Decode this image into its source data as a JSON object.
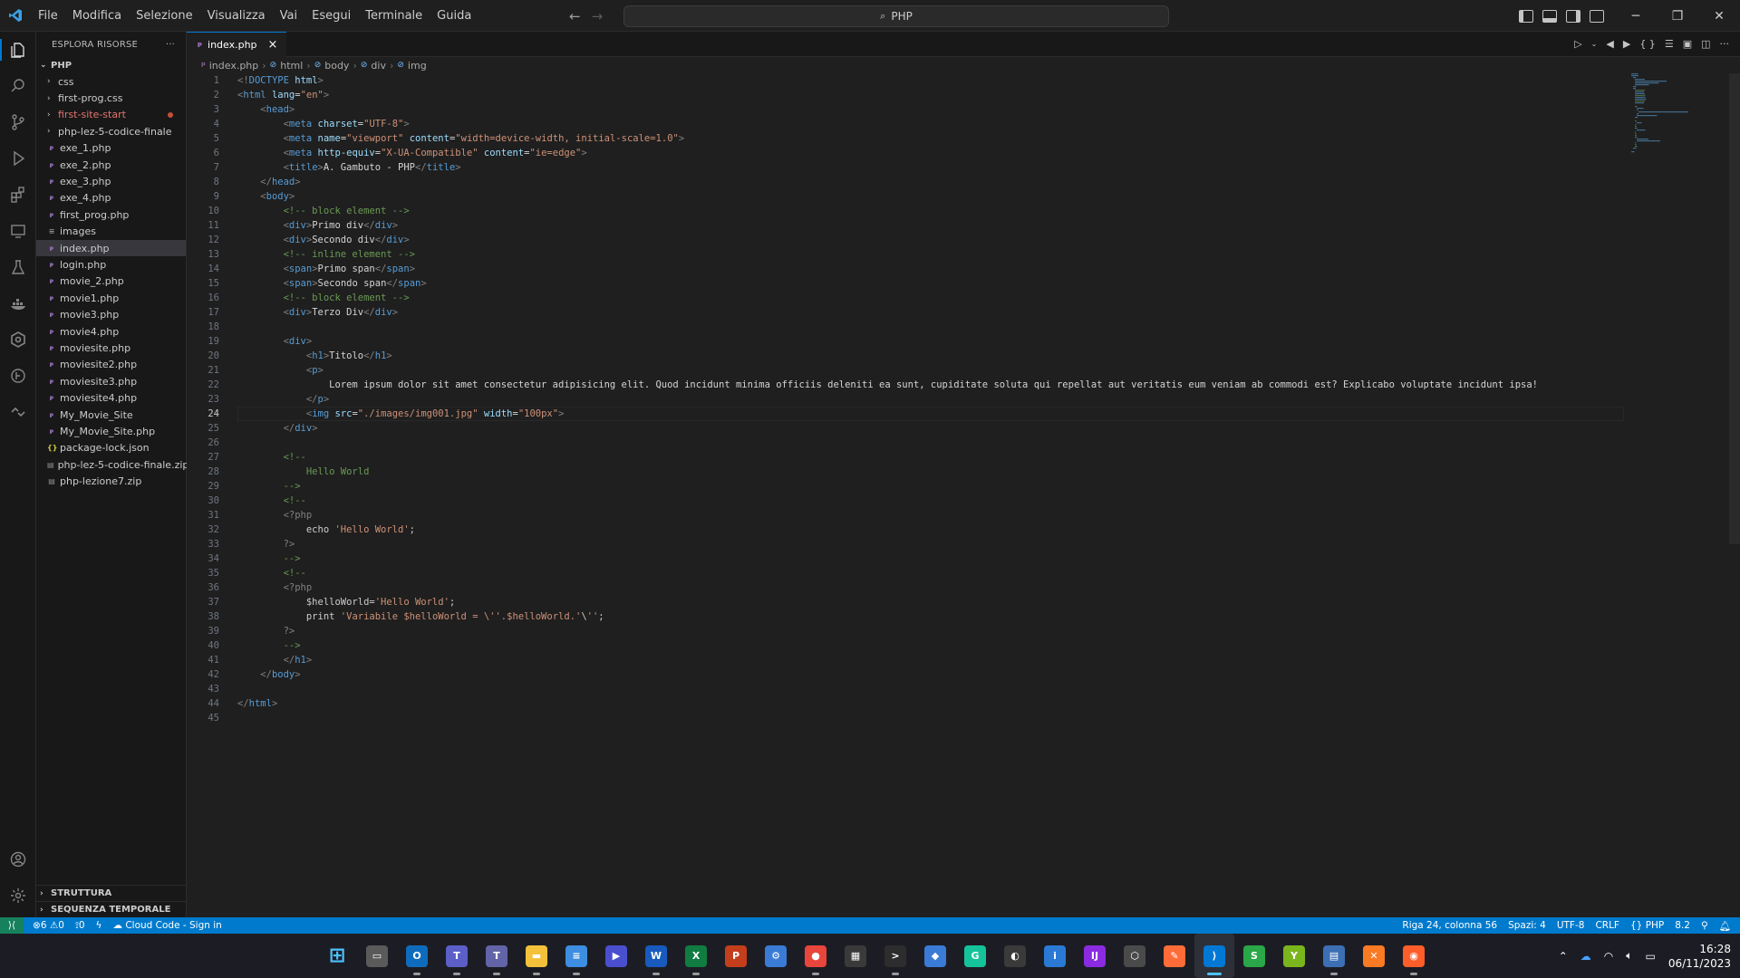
{
  "titlebar": {
    "menu": [
      "File",
      "Modifica",
      "Selezione",
      "Visualizza",
      "Vai",
      "Esegui",
      "Terminale",
      "Guida"
    ],
    "search": "PHP",
    "accent": "#0078d4"
  },
  "sidebar": {
    "title": "ESPLORA RISORSE",
    "more": "···",
    "project": "PHP",
    "items": [
      {
        "label": "css",
        "kind": "folder"
      },
      {
        "label": "first-prog.css",
        "kind": "folder"
      },
      {
        "label": "first-site-start",
        "kind": "folder-modified"
      },
      {
        "label": "php-lez-5-codice-finale",
        "kind": "folder"
      },
      {
        "label": "exe_1.php",
        "kind": "php"
      },
      {
        "label": "exe_2.php",
        "kind": "php"
      },
      {
        "label": "exe_3.php",
        "kind": "php"
      },
      {
        "label": "exe_4.php",
        "kind": "php"
      },
      {
        "label": "first_prog.php",
        "kind": "php"
      },
      {
        "label": "images",
        "kind": "file"
      },
      {
        "label": "index.php",
        "kind": "php-selected"
      },
      {
        "label": "login.php",
        "kind": "php"
      },
      {
        "label": "movie_2.php",
        "kind": "php"
      },
      {
        "label": "movie1.php",
        "kind": "php"
      },
      {
        "label": "movie3.php",
        "kind": "php"
      },
      {
        "label": "movie4.php",
        "kind": "php"
      },
      {
        "label": "moviesite.php",
        "kind": "php"
      },
      {
        "label": "moviesite2.php",
        "kind": "php"
      },
      {
        "label": "moviesite3.php",
        "kind": "php"
      },
      {
        "label": "moviesite4.php",
        "kind": "php"
      },
      {
        "label": "My_Movie_Site",
        "kind": "php"
      },
      {
        "label": "My_Movie_Site.php",
        "kind": "php"
      },
      {
        "label": "package-lock.json",
        "kind": "json"
      },
      {
        "label": "php-lez-5-codice-finale.zip",
        "kind": "zip"
      },
      {
        "label": "php-lezione7.zip",
        "kind": "zip"
      }
    ],
    "outline": "STRUTTURA",
    "timeline": "SEQUENZA TEMPORALE"
  },
  "editor": {
    "tab": "index.php",
    "tab_close": "×",
    "breadcrumb": [
      "index.php",
      "html",
      "body",
      "div",
      "img"
    ],
    "current_line": 24,
    "lines": [
      "<!DOCTYPE html>",
      "<html lang=\"en\">",
      "    <head>",
      "        <meta charset=\"UTF-8\">",
      "        <meta name=\"viewport\" content=\"width=device-width, initial-scale=1.0\">",
      "        <meta http-equiv=\"X-UA-Compatible\" content=\"ie=edge\">",
      "        <title>A. Gambuto - PHP</title>",
      "    </head>",
      "    <body>",
      "        <!-- block element -->",
      "        <div>Primo div</div>",
      "        <div>Secondo div</div>",
      "        <!-- inline element -->",
      "        <span>Primo span</span>",
      "        <span>Secondo span</span>",
      "        <!-- block element -->",
      "        <div>Terzo Div</div>",
      "",
      "        <div>",
      "            <h1>Titolo</h1>",
      "            <p>",
      "                Lorem ipsum dolor sit amet consectetur adipisicing elit. Quod incidunt minima officiis deleniti ea sunt, cupiditate soluta qui repellat aut veritatis eum veniam ab commodi est? Explicabo voluptate incidunt ipsa!",
      "            </p>",
      "            <img src=\"./images/img001.jpg\" width=\"100px\">",
      "        </div>",
      "",
      "        <!--",
      "            Hello World",
      "        -->",
      "        <!--",
      "        <?php",
      "            echo 'Hello World';",
      "        ?>",
      "        -->",
      "        <!--",
      "        <?php",
      "            $helloWorld='Hello World';",
      "            print 'Variabile $helloWorld = \\''.$helloWorld.'\\'';",
      "        ?>",
      "        -->",
      "        </h1>",
      "    </body>",
      "",
      "</html>",
      ""
    ]
  },
  "statusbar": {
    "errors": "6",
    "warnings": "0",
    "ports": "0",
    "cloud": "Cloud Code - Sign in",
    "position": "Riga 24, colonna 56",
    "spaces": "Spazi: 4",
    "encoding": "UTF-8",
    "eol": "CRLF",
    "language": "PHP",
    "version": "8.2"
  },
  "taskbar": {
    "apps": [
      {
        "name": "start",
        "color": "#4cc2ff",
        "glyph": "⊞"
      },
      {
        "name": "task-view",
        "color": "#5a5a5a",
        "glyph": "▭"
      },
      {
        "name": "outlook",
        "color": "#0f6cbd",
        "glyph": "O"
      },
      {
        "name": "teams-work",
        "color": "#5b5fc7",
        "glyph": "T"
      },
      {
        "name": "teams",
        "color": "#6264a7",
        "glyph": "T"
      },
      {
        "name": "file-explorer",
        "color": "#f3c13a",
        "glyph": "▬"
      },
      {
        "name": "notepad",
        "color": "#3d8de0",
        "glyph": "≡"
      },
      {
        "name": "clipchamp",
        "color": "#4a4fcf",
        "glyph": "▶"
      },
      {
        "name": "word",
        "color": "#185abd",
        "glyph": "W"
      },
      {
        "name": "excel",
        "color": "#107c41",
        "glyph": "X"
      },
      {
        "name": "powerpoint",
        "color": "#c43e1c",
        "glyph": "P"
      },
      {
        "name": "control-panel",
        "color": "#3a7bd5",
        "glyph": "⚙"
      },
      {
        "name": "chrome",
        "color": "#e8453c",
        "glyph": "●"
      },
      {
        "name": "store",
        "color": "#3a3a3a",
        "glyph": "▦"
      },
      {
        "name": "terminal",
        "color": "#2d2d2d",
        "glyph": ">"
      },
      {
        "name": "git",
        "color": "#3a7bd5",
        "glyph": "◆"
      },
      {
        "name": "grammarly",
        "color": "#15c39a",
        "glyph": "G"
      },
      {
        "name": "mongodb",
        "color": "#3a3a3a",
        "glyph": "◐"
      },
      {
        "name": "app-blue",
        "color": "#2a7ad5",
        "glyph": "i"
      },
      {
        "name": "intellij",
        "color": "#8a2be2",
        "glyph": "IJ"
      },
      {
        "name": "virtualbox",
        "color": "#4a4a4a",
        "glyph": "⬡"
      },
      {
        "name": "postman",
        "color": "#ff6c37",
        "glyph": "✎"
      },
      {
        "name": "vscode",
        "color": "#0078d4",
        "glyph": "⟩"
      },
      {
        "name": "app-green",
        "color": "#2aa748",
        "glyph": "S"
      },
      {
        "name": "app-yellowgreen",
        "color": "#7ab51d",
        "glyph": "Y"
      },
      {
        "name": "network",
        "color": "#3c6fb4",
        "glyph": "▤"
      },
      {
        "name": "xampp",
        "color": "#fb7a24",
        "glyph": "✕"
      },
      {
        "name": "firefox",
        "color": "#ff5e2b",
        "glyph": "◉"
      }
    ],
    "time": "16:28",
    "date": "06/11/2023"
  }
}
